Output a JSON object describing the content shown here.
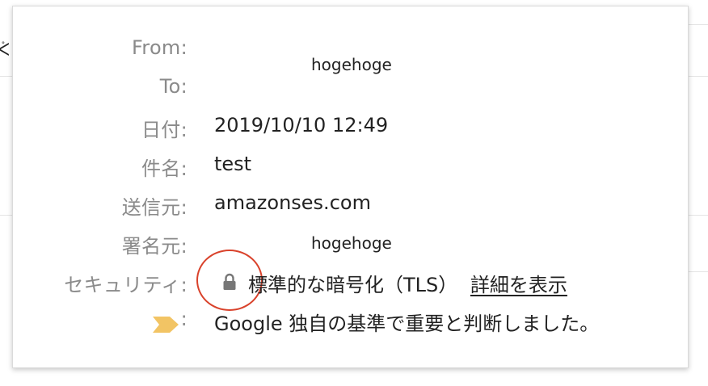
{
  "background": {
    "left_glyph": "ᢵ"
  },
  "details": {
    "from_label": "From:",
    "from_value": "hogehoge",
    "to_label": "To:",
    "date_label": "日付:",
    "date_value": "2019/10/10 12:49",
    "subject_label": "件名:",
    "subject_value": "test",
    "mailed_by_label": "送信元:",
    "mailed_by_value": "amazonses.com",
    "signed_by_label": "署名元:",
    "signed_by_value": "hogehoge",
    "security_label": "セキュリティ:",
    "security_value": "標準的な暗号化（TLS）",
    "security_link": "詳細を表示",
    "importance_colon": ":",
    "importance_value": "Google 独自の基準で重要と判断しました。"
  },
  "icons": {
    "lock": "lock-icon",
    "importance": "importance-marker-icon"
  },
  "colors": {
    "label": "#8a8a8a",
    "value": "#222222",
    "annotation_circle": "#d9422b",
    "importance_marker": "#f2c464",
    "lock": "#777777"
  }
}
